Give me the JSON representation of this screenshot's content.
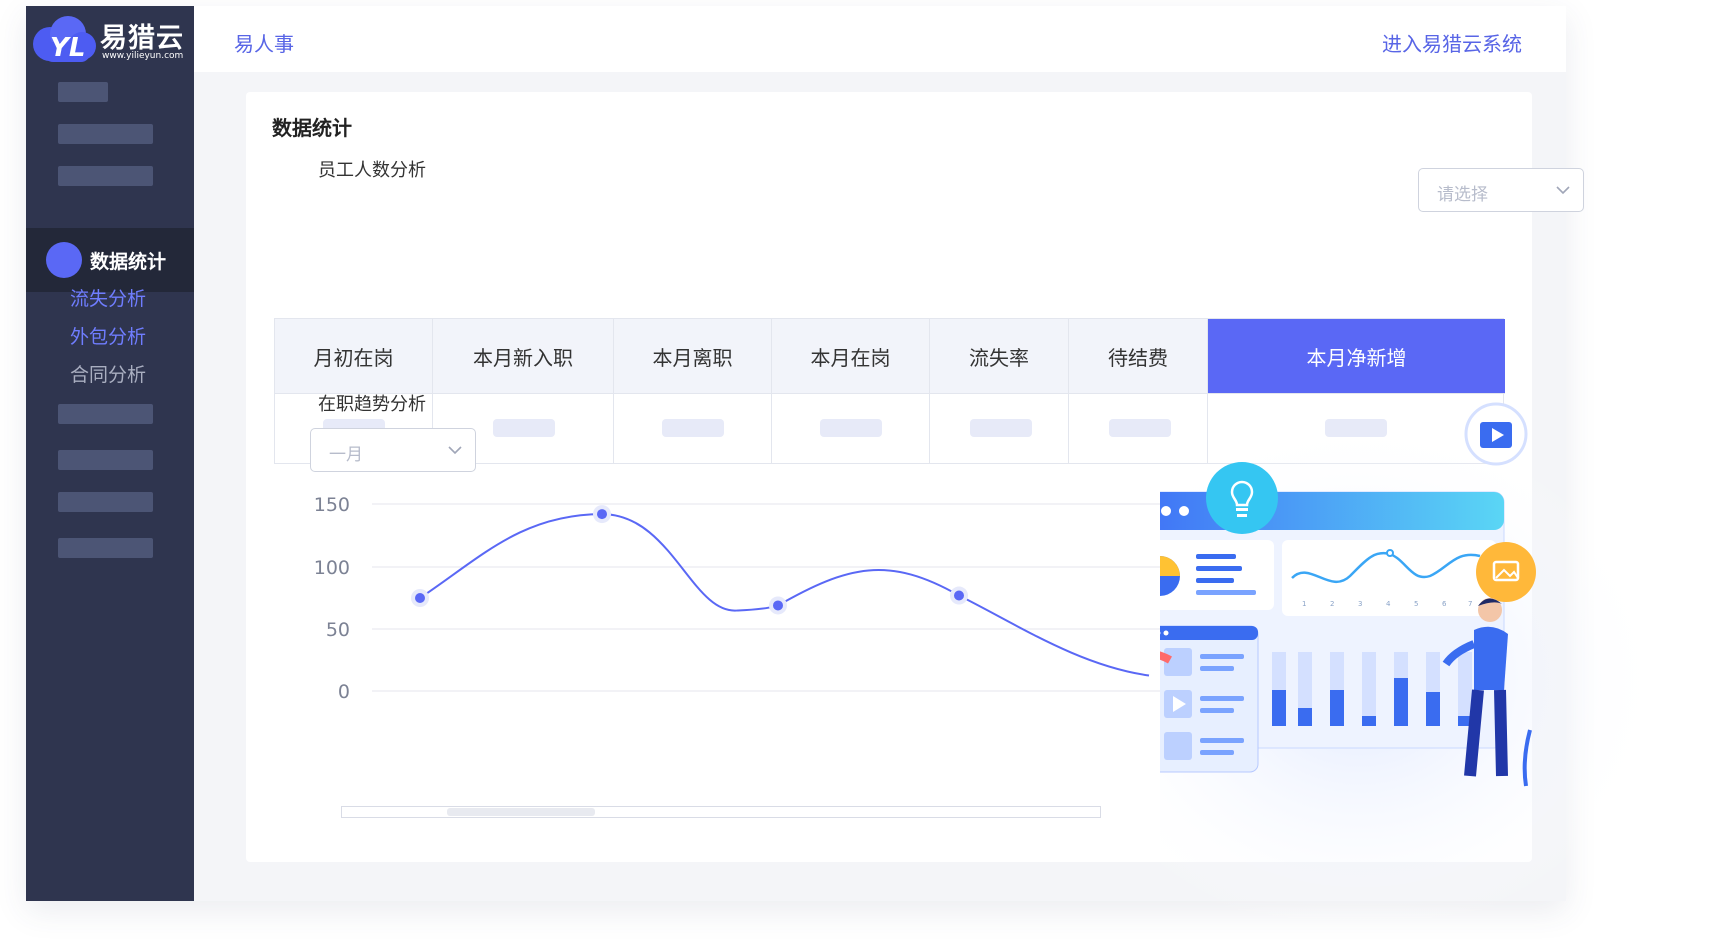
{
  "brand": {
    "logo_text": "易猎云",
    "url_text": "www.yilieyun.com"
  },
  "sidebar": {
    "active_item": "数据统计",
    "sub_items": [
      "流失分析",
      "外包分析",
      "合同分析"
    ]
  },
  "header": {
    "left_title": "易人事",
    "right_link": "进入易猎云系统"
  },
  "card": {
    "title": "数据统计",
    "section1_title": "员工人数分析",
    "section1_select_placeholder": "请选择",
    "table_headers": [
      "月初在岗",
      "本月新入职",
      "本月离职",
      "本月在岗",
      "流失率",
      "待结费",
      "本月净新增"
    ],
    "active_header_index": 6,
    "section2_title": "在职趋势分析",
    "section2_select_value": "一月"
  },
  "colors": {
    "sidebar_bg": "#2f354f",
    "accent": "#5a68f5",
    "link": "#5865e6"
  },
  "chart_data": {
    "type": "line",
    "y_ticks": [
      150,
      100,
      50,
      0
    ],
    "ylim": [
      0,
      150
    ],
    "points": [
      {
        "x": 0,
        "y": 75
      },
      {
        "x": 1,
        "y": 142
      },
      {
        "x": 2,
        "y": 69
      },
      {
        "x": 3,
        "y": 77
      }
    ],
    "grid": true,
    "title": "",
    "xlabel": "",
    "ylabel": ""
  }
}
